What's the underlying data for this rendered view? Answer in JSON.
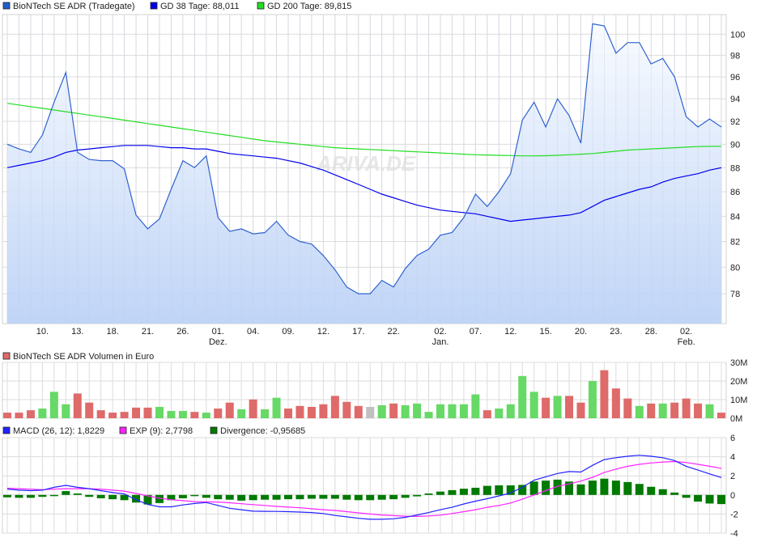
{
  "watermark": "ARIVA.DE",
  "colors": {
    "price": "#2f62d0",
    "gd38": "#0000ee",
    "gd200": "#22dd22",
    "vol_up": "#66d966",
    "vol_down": "#df6a6a",
    "vol_flat": "#c0c0c0",
    "macd": "#2222ff",
    "exp": "#ff22ff",
    "divergence": "#007a00"
  },
  "chart_data": [
    {
      "type": "line",
      "scale": "log",
      "legend": [
        {
          "label": "BioNTech SE ADR (Tradegate)",
          "color": "#1f5fc8"
        },
        {
          "label": "GD 38 Tage: 88,011",
          "color": "#0000ee"
        },
        {
          "label": "GD 200 Tage: 89,815",
          "color": "#22dd22"
        }
      ],
      "legend_position": "top-left",
      "ylim": [
        75.8,
        101.9
      ],
      "yticks": [
        78,
        80,
        82,
        84,
        86,
        88,
        90,
        92,
        94,
        96,
        98,
        100
      ],
      "xticks": [
        {
          "i": 3,
          "label": "10."
        },
        {
          "i": 6,
          "label": "13."
        },
        {
          "i": 9,
          "label": "18."
        },
        {
          "i": 12,
          "label": "21."
        },
        {
          "i": 15,
          "label": "26."
        },
        {
          "i": 18,
          "label": "01.",
          "sub": "Dez."
        },
        {
          "i": 21,
          "label": "04."
        },
        {
          "i": 24,
          "label": "09."
        },
        {
          "i": 27,
          "label": "12."
        },
        {
          "i": 30,
          "label": "17."
        },
        {
          "i": 33,
          "label": "22."
        },
        {
          "i": 37,
          "label": "02.",
          "sub": "Jan."
        },
        {
          "i": 40,
          "label": "07."
        },
        {
          "i": 43,
          "label": "12."
        },
        {
          "i": 46,
          "label": "15."
        },
        {
          "i": 49,
          "label": "20."
        },
        {
          "i": 52,
          "label": "23."
        },
        {
          "i": 55,
          "label": "28."
        },
        {
          "i": 58,
          "label": "02.",
          "sub": "Feb."
        }
      ],
      "series": [
        {
          "name": "BioNTech SE ADR (Tradegate)",
          "values": [
            90.0,
            89.6,
            89.3,
            90.8,
            93.7,
            96.4,
            89.3,
            88.7,
            88.6,
            88.6,
            87.9,
            84.1,
            83.0,
            83.8,
            86.2,
            88.6,
            88.0,
            89.0,
            83.9,
            82.8,
            83.0,
            82.6,
            82.7,
            83.6,
            82.5,
            82.0,
            81.8,
            80.9,
            79.8,
            78.5,
            78.0,
            78.0,
            79.0,
            78.5,
            79.9,
            80.9,
            81.4,
            82.5,
            82.7,
            83.9,
            85.8,
            84.8,
            86.0,
            87.5,
            92.1,
            93.7,
            91.5,
            94.0,
            92.5,
            90.1,
            101.0,
            100.8,
            98.2,
            99.2,
            99.2,
            97.2,
            97.7,
            96.0,
            92.4,
            91.5,
            92.2,
            91.5
          ]
        },
        {
          "name": "GD 38 Tage",
          "values": [
            88.0,
            88.2,
            88.4,
            88.6,
            88.9,
            89.3,
            89.5,
            89.6,
            89.7,
            89.8,
            89.9,
            89.9,
            89.9,
            89.8,
            89.7,
            89.7,
            89.6,
            89.6,
            89.4,
            89.2,
            89.1,
            89.0,
            88.9,
            88.8,
            88.6,
            88.4,
            88.1,
            87.8,
            87.4,
            87.0,
            86.6,
            86.2,
            85.8,
            85.5,
            85.2,
            84.9,
            84.7,
            84.5,
            84.4,
            84.3,
            84.2,
            84.0,
            83.8,
            83.6,
            83.7,
            83.8,
            83.9,
            84.0,
            84.1,
            84.3,
            84.8,
            85.3,
            85.6,
            85.9,
            86.2,
            86.4,
            86.8,
            87.1,
            87.3,
            87.5,
            87.8,
            88.0
          ]
        },
        {
          "name": "GD 200 Tage",
          "values": [
            93.6,
            93.45,
            93.3,
            93.15,
            93.0,
            92.85,
            92.7,
            92.55,
            92.4,
            92.25,
            92.1,
            91.95,
            91.8,
            91.65,
            91.5,
            91.35,
            91.2,
            91.05,
            90.9,
            90.75,
            90.6,
            90.45,
            90.3,
            90.2,
            90.1,
            90.0,
            89.9,
            89.8,
            89.7,
            89.65,
            89.6,
            89.55,
            89.5,
            89.45,
            89.4,
            89.35,
            89.3,
            89.25,
            89.2,
            89.15,
            89.1,
            89.08,
            89.05,
            89.03,
            89.0,
            89.0,
            89.02,
            89.05,
            89.1,
            89.15,
            89.2,
            89.3,
            89.4,
            89.5,
            89.55,
            89.6,
            89.65,
            89.7,
            89.75,
            89.8,
            89.82,
            89.83
          ]
        }
      ]
    },
    {
      "type": "bar",
      "title": "BioNTech SE ADR Volumen in Euro",
      "legend_color": "#df6a6a",
      "unit": "M",
      "ylim": [
        0,
        30
      ],
      "yticks": [
        {
          "v": 0,
          "label": "0M"
        },
        {
          "v": 10,
          "label": "10M"
        },
        {
          "v": 20,
          "label": "20M"
        },
        {
          "v": 30,
          "label": "30M"
        }
      ],
      "values": [
        3,
        3,
        4.3,
        5.2,
        14.2,
        7.5,
        13.3,
        8.4,
        4.3,
        3,
        3.4,
        5.7,
        5.7,
        6.1,
        3.9,
        3.9,
        3.4,
        3,
        5.2,
        8.4,
        4.8,
        10.1,
        4.8,
        11,
        5.2,
        6.6,
        6.1,
        7.5,
        12,
        8.8,
        6.6,
        6.1,
        7,
        7.9,
        7,
        7.9,
        3.4,
        7.5,
        7.5,
        7.5,
        12.8,
        4.3,
        5.2,
        7.5,
        22.7,
        14.2,
        11,
        12,
        12,
        8.4,
        20,
        25.8,
        16,
        10.6,
        6.6,
        7.9,
        7.9,
        8.4,
        10.6,
        7.9,
        7.5,
        3
      ],
      "direction": [
        "d",
        "d",
        "d",
        "u",
        "u",
        "u",
        "d",
        "d",
        "d",
        "d",
        "d",
        "d",
        "d",
        "u",
        "u",
        "u",
        "d",
        "u",
        "d",
        "d",
        "u",
        "d",
        "u",
        "u",
        "d",
        "d",
        "d",
        "d",
        "d",
        "d",
        "d",
        "f",
        "u",
        "d",
        "u",
        "u",
        "u",
        "u",
        "u",
        "u",
        "u",
        "d",
        "u",
        "u",
        "u",
        "u",
        "d",
        "u",
        "d",
        "d",
        "u",
        "d",
        "d",
        "d",
        "u",
        "d",
        "u",
        "d",
        "d",
        "d",
        "u",
        "d"
      ]
    },
    {
      "type": "line",
      "legend": [
        {
          "label": "MACD (26, 12): 1,8229",
          "color": "#2222ff"
        },
        {
          "label": "EXP (9): 2,7798",
          "color": "#ff22ff"
        },
        {
          "label": "Divergence: -0,95685",
          "color": "#007a00"
        }
      ],
      "ylim": [
        -4,
        6
      ],
      "yticks": [
        -4,
        -2,
        0,
        2,
        4,
        6
      ],
      "series": [
        {
          "name": "MACD (26, 12)",
          "values": [
            0.6,
            0.5,
            0.45,
            0.5,
            0.8,
            1.0,
            0.8,
            0.65,
            0.45,
            0.25,
            0.1,
            -0.5,
            -1.0,
            -1.25,
            -1.25,
            -1.05,
            -0.9,
            -0.8,
            -1.1,
            -1.4,
            -1.55,
            -1.7,
            -1.72,
            -1.73,
            -1.75,
            -1.8,
            -1.85,
            -1.95,
            -2.15,
            -2.3,
            -2.45,
            -2.55,
            -2.55,
            -2.5,
            -2.35,
            -2.1,
            -1.85,
            -1.55,
            -1.3,
            -0.95,
            -0.65,
            -0.4,
            -0.1,
            0.2,
            0.8,
            1.55,
            1.9,
            2.25,
            2.45,
            2.4,
            3.1,
            3.7,
            3.9,
            4.05,
            4.15,
            4.05,
            3.9,
            3.6,
            3.0,
            2.6,
            2.2,
            1.82
          ]
        },
        {
          "name": "EXP (9)",
          "values": [
            0.7,
            0.65,
            0.6,
            0.55,
            0.6,
            0.65,
            0.65,
            0.65,
            0.6,
            0.5,
            0.4,
            0.15,
            -0.1,
            -0.35,
            -0.5,
            -0.6,
            -0.7,
            -0.72,
            -0.75,
            -0.82,
            -0.92,
            -1.02,
            -1.1,
            -1.2,
            -1.28,
            -1.35,
            -1.45,
            -1.55,
            -1.63,
            -1.75,
            -1.88,
            -2.0,
            -2.1,
            -2.17,
            -2.23,
            -2.25,
            -2.2,
            -2.12,
            -1.95,
            -1.75,
            -1.55,
            -1.3,
            -1.1,
            -0.85,
            -0.45,
            0.0,
            0.45,
            0.9,
            1.15,
            1.45,
            1.85,
            2.35,
            2.7,
            3.0,
            3.2,
            3.35,
            3.45,
            3.5,
            3.4,
            3.2,
            3.0,
            2.78
          ]
        },
        {
          "name": "Divergence",
          "type": "bar",
          "values": [
            -0.25,
            -0.3,
            -0.3,
            -0.2,
            -0.05,
            0.4,
            0.15,
            -0.2,
            -0.35,
            -0.45,
            -0.55,
            -0.8,
            -1.0,
            -0.85,
            -0.55,
            -0.35,
            -0.1,
            -0.3,
            -0.45,
            -0.5,
            -0.6,
            -0.55,
            -0.5,
            -0.5,
            -0.45,
            -0.45,
            -0.4,
            -0.4,
            -0.4,
            -0.5,
            -0.55,
            -0.55,
            -0.5,
            -0.45,
            -0.3,
            -0.15,
            0.15,
            0.35,
            0.5,
            0.65,
            0.75,
            0.95,
            1.0,
            1.0,
            1.05,
            1.4,
            1.5,
            1.6,
            1.4,
            1.1,
            1.5,
            1.7,
            1.5,
            1.35,
            1.15,
            0.85,
            0.6,
            0.25,
            -0.3,
            -0.7,
            -0.9,
            -0.96
          ]
        }
      ]
    }
  ]
}
